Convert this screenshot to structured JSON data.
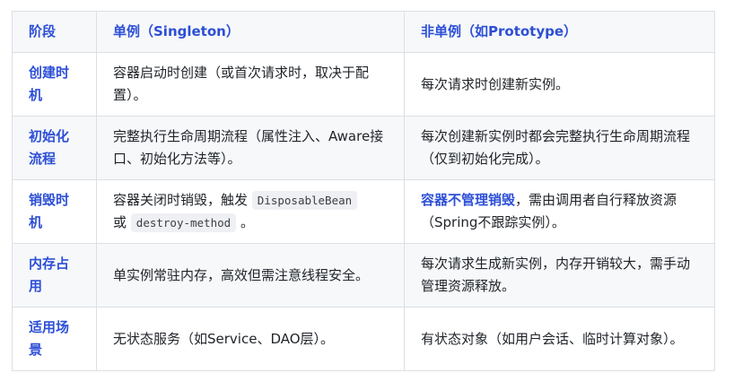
{
  "header": {
    "col1": "阶段",
    "col2": "单例（Singleton）",
    "col3": "非单例（如Prototype）"
  },
  "rows": [
    {
      "stage": "创建时机",
      "singleton": "容器启动时创建（或首次请求时，取决于配置）。",
      "prototype": "每次请求时创建新实例。"
    },
    {
      "stage": "初始化流程",
      "singleton": "完整执行生命周期流程（属性注入、Aware接口、初始化方法等）。",
      "prototype": "每次创建新实例时都会完整执行生命周期流程（仅到初始化完成）。"
    },
    {
      "stage": "销毁时机",
      "singleton_pre": "容器关闭时销毁，触发",
      "singleton_code1": "DisposableBean",
      "singleton_or": "或",
      "singleton_code2": "destroy-method",
      "singleton_end": "。",
      "prototype_strong": "容器不管理销毁",
      "prototype_rest": "，需由调用者自行释放资源（Spring不跟踪实例）。"
    },
    {
      "stage": "内存占用",
      "singleton": "单实例常驻内存，高效但需注意线程安全。",
      "prototype": "每次请求生成新实例，内存开销较大，需手动管理资源释放。"
    },
    {
      "stage": "适用场景",
      "singleton": "无状态服务（如Service、DAO层）。",
      "prototype": "有状态对象（如用户会话、临时计算对象）。"
    }
  ]
}
